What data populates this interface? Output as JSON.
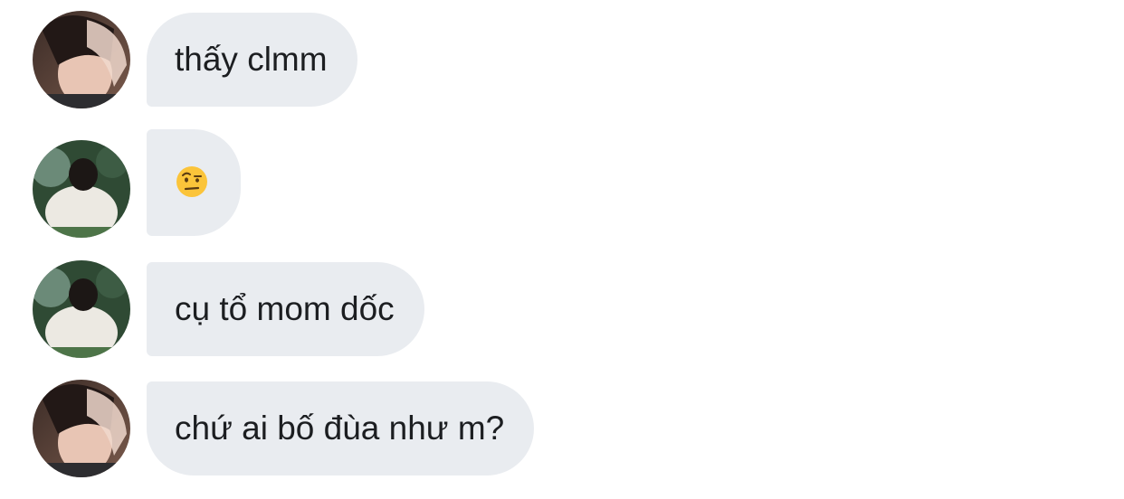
{
  "messages": [
    {
      "avatar": "avatar-bangs-selfie",
      "text": "thấy clmm"
    },
    {
      "avatar": "avatar-white-shirt-outdoor",
      "emoji": "face-with-raised-eyebrow-emoji"
    },
    {
      "avatar": "avatar-white-shirt-outdoor",
      "text": "cụ tổ mom dốc"
    },
    {
      "avatar": "avatar-bangs-selfie",
      "text": "chứ ai bố đùa như m?"
    }
  ],
  "colors": {
    "bubble_background": "#e9ecf0",
    "text": "#1c1e21",
    "page_background": "#ffffff"
  }
}
